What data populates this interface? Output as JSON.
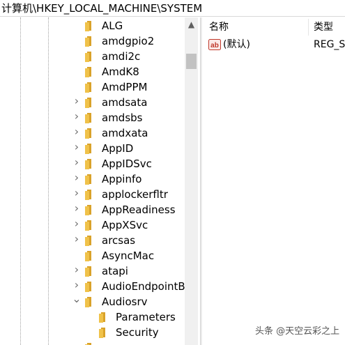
{
  "address_bar": {
    "path": "计算机\\HKEY_LOCAL_MACHINE\\SYSTEM"
  },
  "tree": {
    "items": [
      {
        "label": "ALG",
        "expander": "none",
        "level": 1
      },
      {
        "label": "amdgpio2",
        "expander": "none",
        "level": 1
      },
      {
        "label": "amdi2c",
        "expander": "none",
        "level": 1
      },
      {
        "label": "AmdK8",
        "expander": "none",
        "level": 1
      },
      {
        "label": "AmdPPM",
        "expander": "none",
        "level": 1
      },
      {
        "label": "amdsata",
        "expander": "collapsed",
        "level": 1
      },
      {
        "label": "amdsbs",
        "expander": "collapsed",
        "level": 1
      },
      {
        "label": "amdxata",
        "expander": "collapsed",
        "level": 1
      },
      {
        "label": "AppID",
        "expander": "collapsed",
        "level": 1
      },
      {
        "label": "AppIDSvc",
        "expander": "collapsed",
        "level": 1
      },
      {
        "label": "Appinfo",
        "expander": "collapsed",
        "level": 1
      },
      {
        "label": "applockerfltr",
        "expander": "collapsed",
        "level": 1
      },
      {
        "label": "AppReadiness",
        "expander": "collapsed",
        "level": 1
      },
      {
        "label": "AppXSvc",
        "expander": "collapsed",
        "level": 1
      },
      {
        "label": "arcsas",
        "expander": "collapsed",
        "level": 1
      },
      {
        "label": "AsyncMac",
        "expander": "none",
        "level": 1
      },
      {
        "label": "atapi",
        "expander": "collapsed",
        "level": 1
      },
      {
        "label": "AudioEndpointB",
        "expander": "collapsed",
        "level": 1
      },
      {
        "label": "Audiosrv",
        "expander": "expanded",
        "level": 1
      },
      {
        "label": "Parameters",
        "expander": "none",
        "level": 2
      },
      {
        "label": "Security",
        "expander": "none",
        "level": 2
      },
      {
        "label": "",
        "expander": "none",
        "level": 1
      }
    ]
  },
  "list": {
    "columns": {
      "name": "名称",
      "type": "类型"
    },
    "rows": [
      {
        "name": "(默认)",
        "type": "REG_S",
        "icon": "reg-string-icon"
      }
    ]
  },
  "watermark": "头条 @天空云彩之上",
  "colors": {
    "folder": "#f0c24a",
    "folder_dark": "#d9a22a",
    "scrollbar_thumb": "#c2c2c2",
    "reg_string_icon": "#c0392b"
  }
}
